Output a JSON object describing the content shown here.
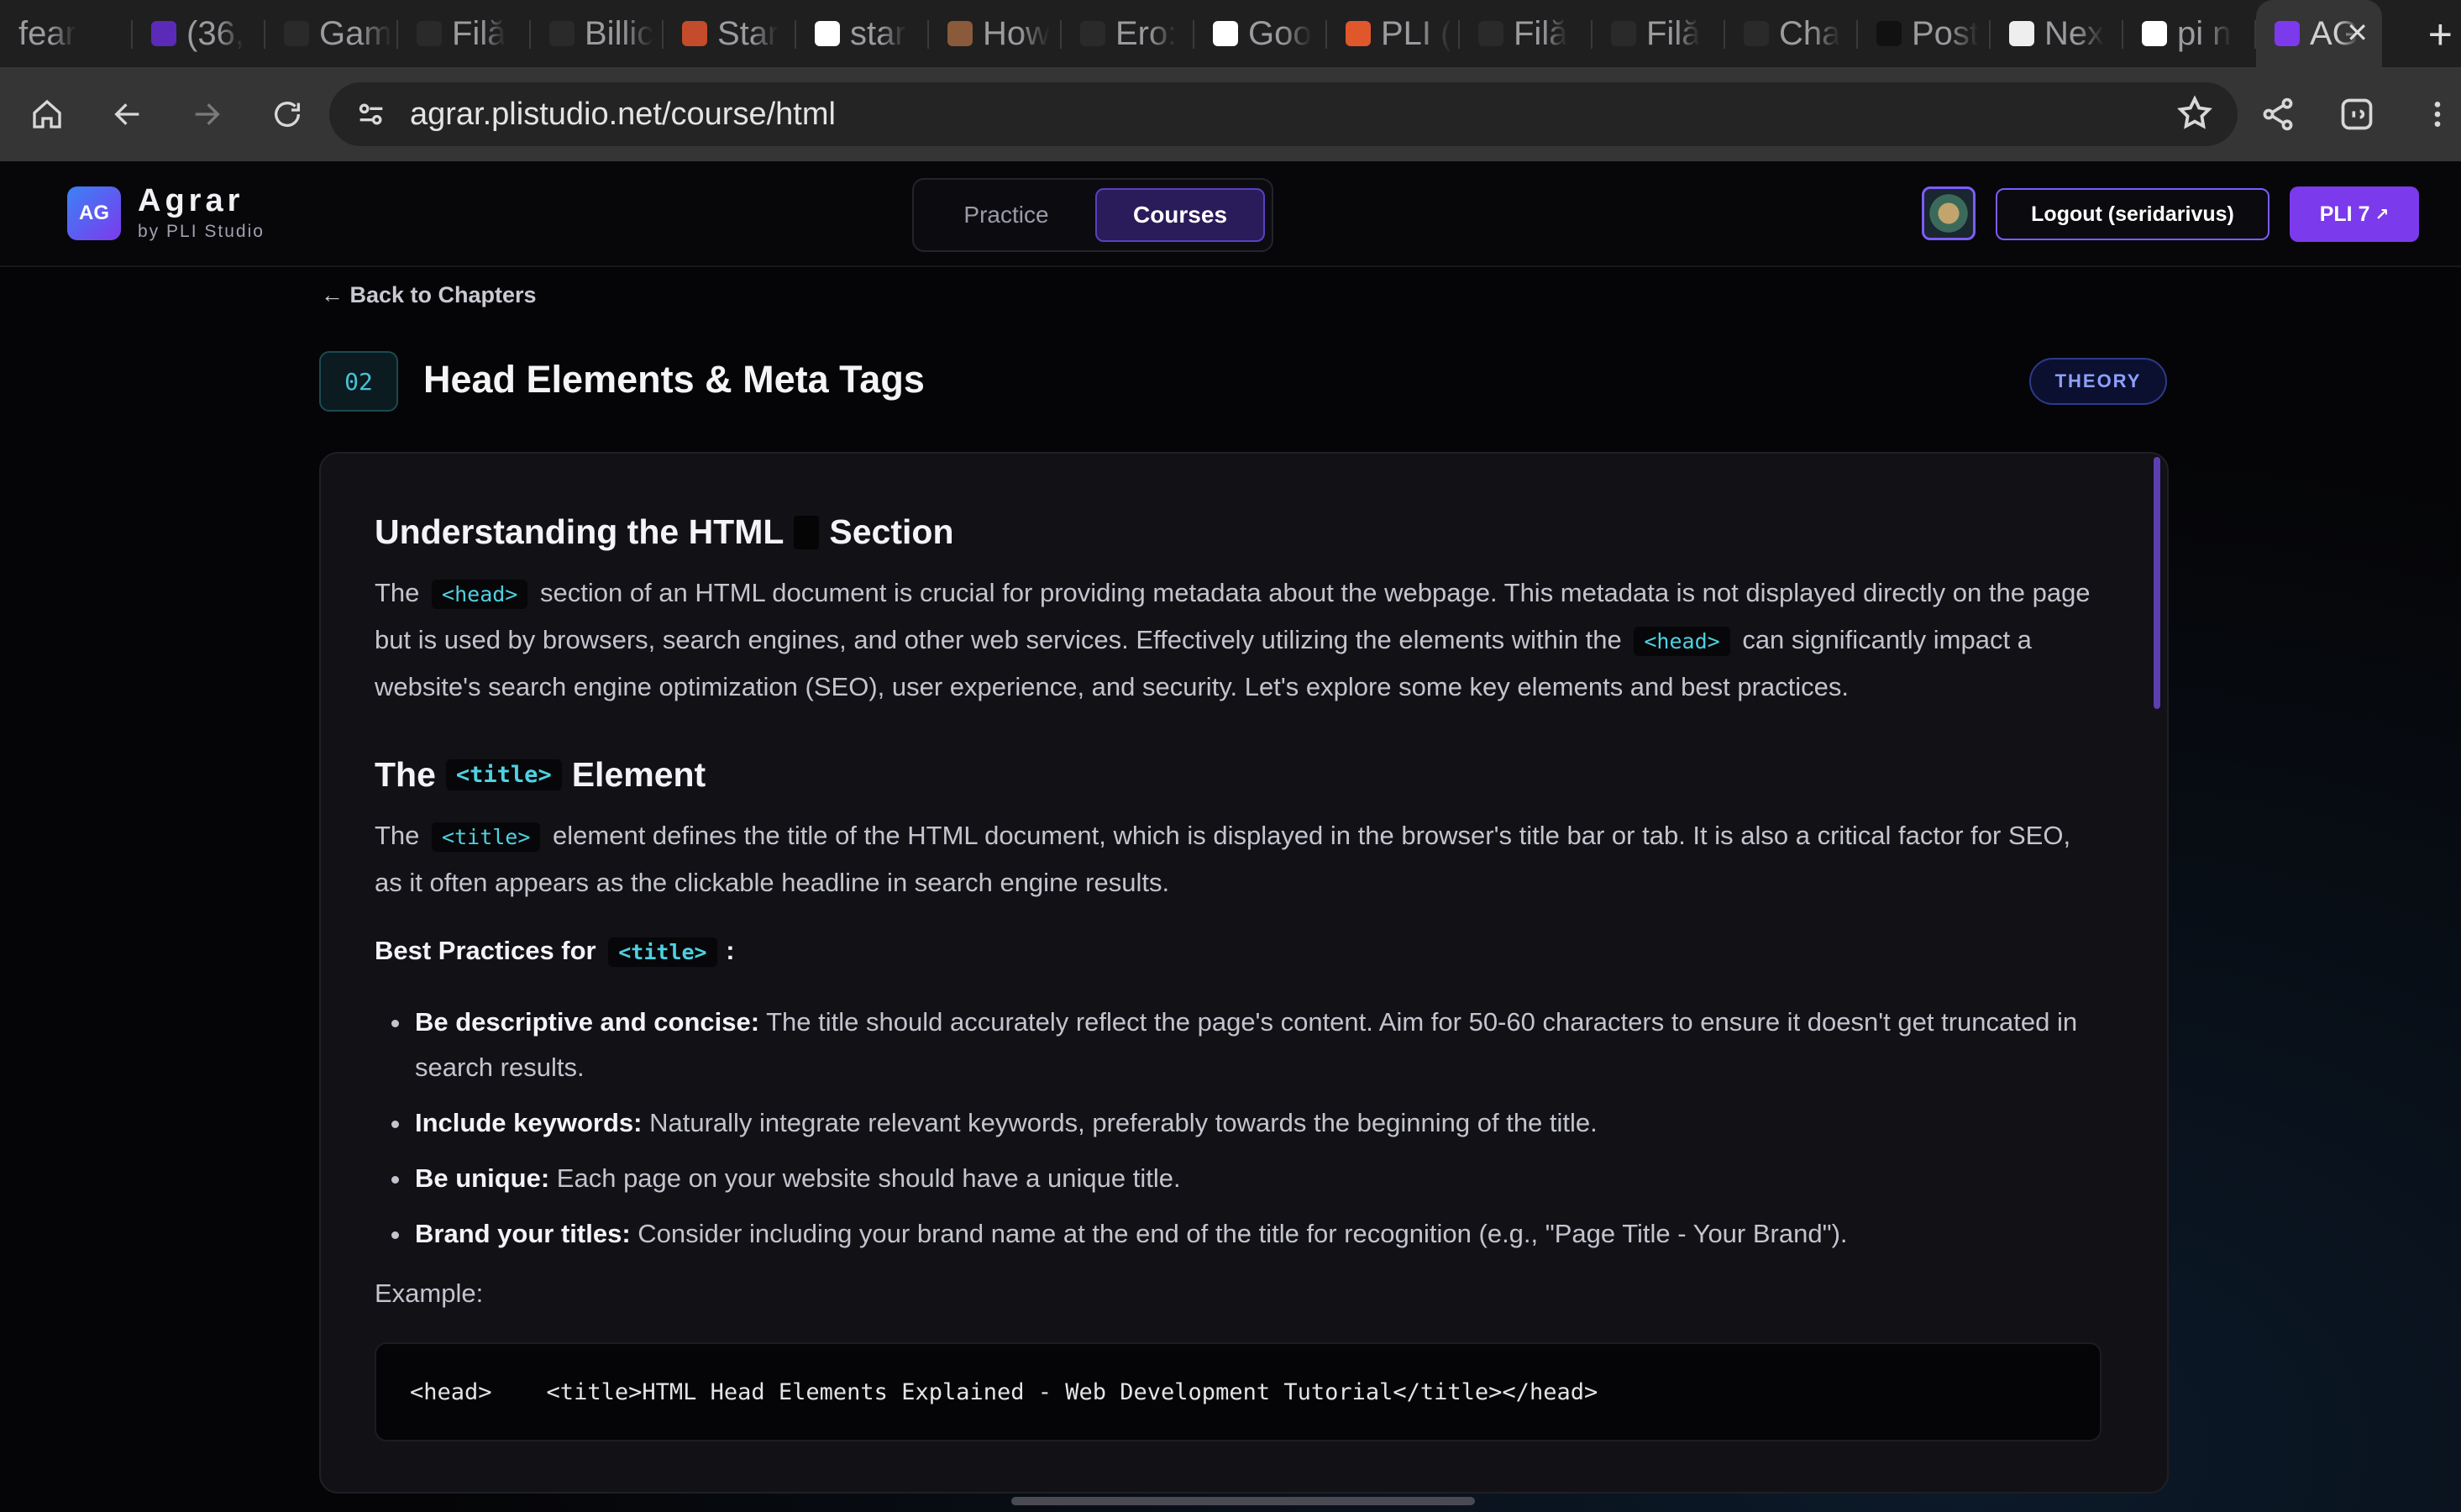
{
  "browser": {
    "tabs": [
      {
        "label": "fear",
        "icon": "blank-icon",
        "color": "#1f1f1f"
      },
      {
        "label": "(36,",
        "icon": "yahoo-mail-icon",
        "color": "#5b2ab8"
      },
      {
        "label": "Gam",
        "icon": "chatgpt-icon",
        "color": "#2a2a2a"
      },
      {
        "label": "Filă",
        "icon": "openai-icon",
        "color": "#2a2a2a"
      },
      {
        "label": "Billic",
        "icon": "chatgpt-icon",
        "color": "#2a2a2a"
      },
      {
        "label": "Star",
        "icon": "site-icon",
        "color": "#c44b2b"
      },
      {
        "label": "star",
        "icon": "google-icon",
        "color": "#ffffff"
      },
      {
        "label": "How",
        "icon": "site-icon",
        "color": "#8a5a3a"
      },
      {
        "label": "Ero:",
        "icon": "globe-icon",
        "color": "#2a2a2a"
      },
      {
        "label": "Goo",
        "icon": "google-icon",
        "color": "#ffffff"
      },
      {
        "label": "PLI (",
        "icon": "flame-icon",
        "color": "#e0572c"
      },
      {
        "label": "Filă",
        "icon": "openai-icon",
        "color": "#2a2a2a"
      },
      {
        "label": "Filă",
        "icon": "openai-icon",
        "color": "#2a2a2a"
      },
      {
        "label": "Cha",
        "icon": "chatgpt-icon",
        "color": "#2a2a2a"
      },
      {
        "label": "Post",
        "icon": "site-icon",
        "color": "#111111"
      },
      {
        "label": "Nex",
        "icon": "site-icon",
        "color": "#eeeeee"
      },
      {
        "label": "pi n",
        "icon": "google-icon",
        "color": "#ffffff"
      }
    ],
    "active_tab": {
      "label": "AG",
      "icon": "agrar-icon",
      "color": "#7c3aed"
    },
    "url": "agrar.plistudio.net/course/html"
  },
  "nav": {
    "logo": "AG",
    "brand": "Agrar",
    "brand_sub": "by PLI Studio",
    "tabs": {
      "practice": "Practice",
      "courses": "Courses"
    },
    "logout": "Logout (seridarivus)",
    "pli": "PLI 7",
    "pli_arrow": "↗"
  },
  "chapter": {
    "back": "← Back to Chapters",
    "number": "02",
    "title": "Head Elements & Meta Tags",
    "badge": "THEORY"
  },
  "content": {
    "h_section": {
      "pre": "Understanding the HTML",
      "post": "Section"
    },
    "p1": {
      "a": "The",
      "code1": "<head>",
      "b": "section of an HTML document is crucial for providing metadata about the webpage. This metadata is not displayed directly on the page but is used by browsers, search engines, and other web services. Effectively utilizing the elements within the",
      "code2": "<head>",
      "c": "can significantly impact a website's search engine optimization (SEO), user experience, and security. Let's explore some key elements and best practices."
    },
    "h_title": {
      "pre": "The",
      "code": "<title>",
      "post": "Element"
    },
    "p2": {
      "a": "The",
      "code": "<title>",
      "b": "element defines the title of the HTML document, which is displayed in the browser's title bar or tab. It is also a critical factor for SEO, as it often appears as the clickable headline in search engine results."
    },
    "best": {
      "pre": "Best Practices for",
      "code": "<title>",
      "post": ":"
    },
    "list": [
      {
        "bold": "Be descriptive and concise:",
        "text": "The title should accurately reflect the page's content. Aim for 50-60 characters to ensure it doesn't get truncated in search results."
      },
      {
        "bold": "Include keywords:",
        "text": "Naturally integrate relevant keywords, preferably towards the beginning of the title."
      },
      {
        "bold": "Be unique:",
        "text": "Each page on your website should have a unique title."
      },
      {
        "bold": "Brand your titles:",
        "text": "Consider including your brand name at the end of the title for recognition (e.g., \"Page Title - Your Brand\")."
      }
    ],
    "example_label": "Example:",
    "code_example": "<head>    <title>HTML Head Elements Explained - Web Development Tutorial</title></head>"
  }
}
